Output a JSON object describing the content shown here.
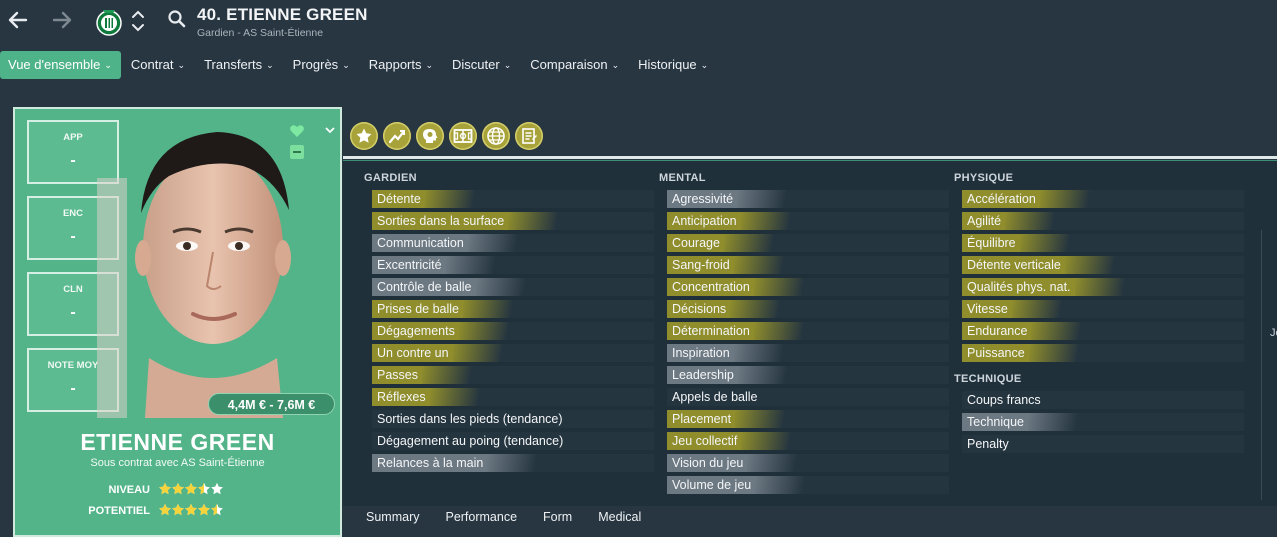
{
  "header": {
    "title": "40. ETIENNE GREEN",
    "subtitle": "Gardien - AS Saint-Étienne",
    "icons": [
      "back-arrow-icon",
      "forward-arrow-icon",
      "club-badge-icon",
      "up-down-chevron-icon",
      "search-icon"
    ]
  },
  "menu": [
    {
      "label": "Vue d'ensemble",
      "active": true
    },
    {
      "label": "Contrat"
    },
    {
      "label": "Transferts"
    },
    {
      "label": "Progrès"
    },
    {
      "label": "Rapports"
    },
    {
      "label": "Discuter"
    },
    {
      "label": "Comparaison"
    },
    {
      "label": "Historique"
    }
  ],
  "card": {
    "stats": [
      {
        "label": "APP",
        "value": "-"
      },
      {
        "label": "ENC",
        "value": "-"
      },
      {
        "label": "CLN",
        "value": "-"
      },
      {
        "label": "NOTE MOY",
        "value": "-"
      }
    ],
    "value_range": "4,4M € - 7,6M €",
    "name": "ETIENNE GREEN",
    "contract": "Sous contrat avec AS Saint-Étienne",
    "niveau_label": "NIVEAU",
    "niveau_stars": 3.5,
    "potentiel_label": "POTENTIEL",
    "potentiel_stars": 4.5,
    "colors": {
      "card": "#53b489",
      "stars": "#f5d33b"
    }
  },
  "tab_icons": [
    "star-icon",
    "progress-chart-icon",
    "head-mind-icon",
    "pitch-icon",
    "globe-icon",
    "report-document-icon"
  ],
  "attributes": {
    "gardien_title": "GARDIEN",
    "gardien": [
      {
        "label": "Détente",
        "hl": "olive"
      },
      {
        "label": "Sorties dans la surface",
        "hl": "olive"
      },
      {
        "label": "Communication",
        "hl": "grey"
      },
      {
        "label": "Excentricité",
        "hl": "grey"
      },
      {
        "label": "Contrôle de balle",
        "hl": "grey"
      },
      {
        "label": "Prises de balle",
        "hl": "olive"
      },
      {
        "label": "Dégagements",
        "hl": "olive"
      },
      {
        "label": "Un contre un",
        "hl": "olive"
      },
      {
        "label": "Passes",
        "hl": "olive"
      },
      {
        "label": "Réflexes",
        "hl": "olive"
      },
      {
        "label": "Sorties dans les pieds (tendance)",
        "hl": "none"
      },
      {
        "label": "Dégagement au poing (tendance)",
        "hl": "none"
      },
      {
        "label": "Relances à la main",
        "hl": "grey"
      }
    ],
    "mental_title": "MENTAL",
    "mental": [
      {
        "label": "Agressivité",
        "hl": "grey"
      },
      {
        "label": "Anticipation",
        "hl": "olive"
      },
      {
        "label": "Courage",
        "hl": "olive"
      },
      {
        "label": "Sang-froid",
        "hl": "olive"
      },
      {
        "label": "Concentration",
        "hl": "olive"
      },
      {
        "label": "Décisions",
        "hl": "olive"
      },
      {
        "label": "Détermination",
        "hl": "olive"
      },
      {
        "label": "Inspiration",
        "hl": "grey"
      },
      {
        "label": "Leadership",
        "hl": "grey"
      },
      {
        "label": "Appels de balle",
        "hl": "none"
      },
      {
        "label": "Placement",
        "hl": "olive"
      },
      {
        "label": "Jeu collectif",
        "hl": "olive"
      },
      {
        "label": "Vision du jeu",
        "hl": "grey"
      },
      {
        "label": "Volume de jeu",
        "hl": "grey"
      }
    ],
    "physique_title": "PHYSIQUE",
    "physique": [
      {
        "label": "Accélération",
        "hl": "olive"
      },
      {
        "label": "Agilité",
        "hl": "olive"
      },
      {
        "label": "Équilibre",
        "hl": "olive"
      },
      {
        "label": "Détente verticale",
        "hl": "olive"
      },
      {
        "label": "Qualités phys. nat.",
        "hl": "olive"
      },
      {
        "label": "Vitesse",
        "hl": "olive"
      },
      {
        "label": "Endurance",
        "hl": "olive"
      },
      {
        "label": "Puissance",
        "hl": "olive"
      }
    ],
    "technique_title": "TECHNIQUE",
    "technique": [
      {
        "label": "Coups francs",
        "hl": "none"
      },
      {
        "label": "Technique",
        "hl": "grey"
      },
      {
        "label": "Penalty",
        "hl": "none"
      }
    ],
    "cut_text": "Je",
    "colors": {
      "olive": "#8f8d2c",
      "grey": "#6c7882"
    }
  },
  "bottom_tabs": [
    "Summary",
    "Performance",
    "Form",
    "Medical"
  ]
}
